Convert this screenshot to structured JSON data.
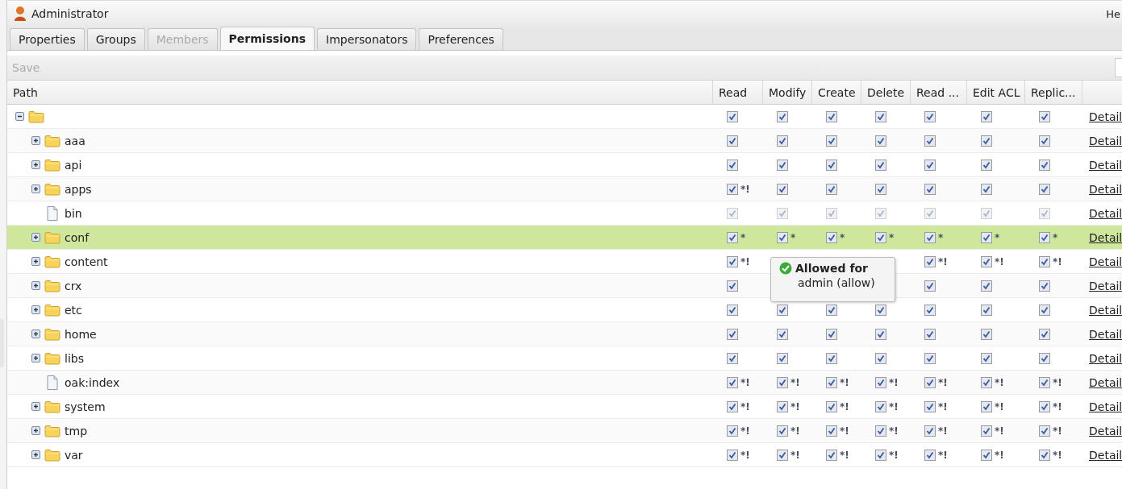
{
  "header": {
    "title": "Administrator",
    "right_text": "He"
  },
  "tabs": [
    {
      "label": "Properties",
      "selected": false,
      "disabled": false
    },
    {
      "label": "Groups",
      "selected": false,
      "disabled": false
    },
    {
      "label": "Members",
      "selected": false,
      "disabled": true
    },
    {
      "label": "Permissions",
      "selected": true,
      "disabled": false
    },
    {
      "label": "Impersonators",
      "selected": false,
      "disabled": false
    },
    {
      "label": "Preferences",
      "selected": false,
      "disabled": false
    }
  ],
  "toolbar": {
    "save_label": "Save",
    "save_disabled": true
  },
  "columns": [
    "Path",
    "Read",
    "Modify",
    "Create",
    "Delete",
    "Read ...",
    "Edit ACL",
    "Replic..."
  ],
  "tree": {
    "kind": "folder",
    "expanded": true,
    "selected": false,
    "disabled": false,
    "link": "Detail",
    "cells": [
      {
        "checked": true
      },
      {
        "checked": true
      },
      {
        "checked": true
      },
      {
        "checked": true
      },
      {
        "checked": true
      },
      {
        "checked": true
      },
      {
        "checked": true
      }
    ],
    "children": [
      {
        "name": "aaa",
        "kind": "folder",
        "expanded": false,
        "selected": false,
        "disabled": false,
        "link": "Detail",
        "cells": [
          {
            "checked": true
          },
          {
            "checked": true
          },
          {
            "checked": true
          },
          {
            "checked": true
          },
          {
            "checked": true
          },
          {
            "checked": true
          },
          {
            "checked": true
          }
        ]
      },
      {
        "name": "api",
        "kind": "folder",
        "expanded": false,
        "selected": false,
        "disabled": false,
        "link": "Detail",
        "cells": [
          {
            "checked": true
          },
          {
            "checked": true
          },
          {
            "checked": true
          },
          {
            "checked": true
          },
          {
            "checked": true
          },
          {
            "checked": true
          },
          {
            "checked": true
          }
        ]
      },
      {
        "name": "apps",
        "kind": "folder",
        "expanded": false,
        "selected": false,
        "disabled": false,
        "link": "Detail",
        "cells": [
          {
            "checked": true,
            "flag": "*!"
          },
          {
            "checked": true
          },
          {
            "checked": true
          },
          {
            "checked": true
          },
          {
            "checked": true
          },
          {
            "checked": true
          },
          {
            "checked": true
          }
        ]
      },
      {
        "name": "bin",
        "kind": "file",
        "selected": false,
        "disabled": true,
        "link": "Detail",
        "cells": [
          {
            "checked": true
          },
          {
            "checked": true
          },
          {
            "checked": true
          },
          {
            "checked": true
          },
          {
            "checked": true
          },
          {
            "checked": true
          },
          {
            "checked": true
          }
        ]
      },
      {
        "name": "conf",
        "kind": "folder",
        "expanded": false,
        "selected": true,
        "disabled": false,
        "link": "Detail",
        "cells": [
          {
            "checked": true,
            "flag": "*"
          },
          {
            "checked": true,
            "flag": "*"
          },
          {
            "checked": true,
            "flag": "*"
          },
          {
            "checked": true,
            "flag": "*"
          },
          {
            "checked": true,
            "flag": "*"
          },
          {
            "checked": true,
            "flag": "*"
          },
          {
            "checked": true,
            "flag": "*"
          }
        ]
      },
      {
        "name": "content",
        "kind": "folder",
        "expanded": false,
        "selected": false,
        "disabled": false,
        "link": "Detail",
        "cells": [
          {
            "checked": true,
            "flag": "*!"
          },
          null,
          null,
          null,
          {
            "checked": true,
            "flag": "*!"
          },
          {
            "checked": true,
            "flag": "*!"
          },
          {
            "checked": true,
            "flag": "*!"
          }
        ]
      },
      {
        "name": "crx",
        "kind": "folder",
        "expanded": false,
        "selected": false,
        "disabled": false,
        "link": "Detail",
        "cells": [
          {
            "checked": true
          },
          null,
          null,
          null,
          {
            "checked": true
          },
          {
            "checked": true
          },
          {
            "checked": true
          }
        ]
      },
      {
        "name": "etc",
        "kind": "folder",
        "expanded": false,
        "selected": false,
        "disabled": false,
        "link": "Detail",
        "cells": [
          {
            "checked": true
          },
          {
            "checked": true
          },
          {
            "checked": true
          },
          {
            "checked": true
          },
          {
            "checked": true
          },
          {
            "checked": true
          },
          {
            "checked": true
          }
        ]
      },
      {
        "name": "home",
        "kind": "folder",
        "expanded": false,
        "selected": false,
        "disabled": false,
        "link": "Detail",
        "cells": [
          {
            "checked": true
          },
          {
            "checked": true
          },
          {
            "checked": true
          },
          {
            "checked": true
          },
          {
            "checked": true
          },
          {
            "checked": true
          },
          {
            "checked": true
          }
        ]
      },
      {
        "name": "libs",
        "kind": "folder",
        "expanded": false,
        "selected": false,
        "disabled": false,
        "link": "Detail",
        "cells": [
          {
            "checked": true
          },
          {
            "checked": true
          },
          {
            "checked": true
          },
          {
            "checked": true
          },
          {
            "checked": true
          },
          {
            "checked": true
          },
          {
            "checked": true
          }
        ]
      },
      {
        "name": "oak:index",
        "kind": "file",
        "selected": false,
        "disabled": false,
        "link": "Detail",
        "cells": [
          {
            "checked": true,
            "flag": "*!"
          },
          {
            "checked": true,
            "flag": "*!"
          },
          {
            "checked": true,
            "flag": "*!"
          },
          {
            "checked": true,
            "flag": "*!"
          },
          {
            "checked": true,
            "flag": "*!"
          },
          {
            "checked": true,
            "flag": "*!"
          },
          {
            "checked": true,
            "flag": "*!"
          }
        ]
      },
      {
        "name": "system",
        "kind": "folder",
        "expanded": false,
        "selected": false,
        "disabled": false,
        "link": "Detail",
        "cells": [
          {
            "checked": true,
            "flag": "*!"
          },
          {
            "checked": true,
            "flag": "*!"
          },
          {
            "checked": true,
            "flag": "*!"
          },
          {
            "checked": true,
            "flag": "*!"
          },
          {
            "checked": true,
            "flag": "*!"
          },
          {
            "checked": true,
            "flag": "*!"
          },
          {
            "checked": true,
            "flag": "*!"
          }
        ]
      },
      {
        "name": "tmp",
        "kind": "folder",
        "expanded": false,
        "selected": false,
        "disabled": false,
        "link": "Detail",
        "cells": [
          {
            "checked": true,
            "flag": "*!"
          },
          {
            "checked": true,
            "flag": "*!"
          },
          {
            "checked": true,
            "flag": "*!"
          },
          {
            "checked": true,
            "flag": "*!"
          },
          {
            "checked": true,
            "flag": "*!"
          },
          {
            "checked": true,
            "flag": "*!"
          },
          {
            "checked": true,
            "flag": "*!"
          }
        ]
      },
      {
        "name": "var",
        "kind": "folder",
        "expanded": false,
        "selected": false,
        "disabled": false,
        "link": "Detail",
        "cells": [
          {
            "checked": true,
            "flag": "*!"
          },
          {
            "checked": true,
            "flag": "*!"
          },
          {
            "checked": true,
            "flag": "*!"
          },
          {
            "checked": true,
            "flag": "*!"
          },
          {
            "checked": true,
            "flag": "*!"
          },
          {
            "checked": true,
            "flag": "*!"
          },
          {
            "checked": true,
            "flag": "*!"
          }
        ]
      }
    ]
  },
  "tooltip": {
    "title": "Allowed for",
    "text": "admin (allow)"
  }
}
